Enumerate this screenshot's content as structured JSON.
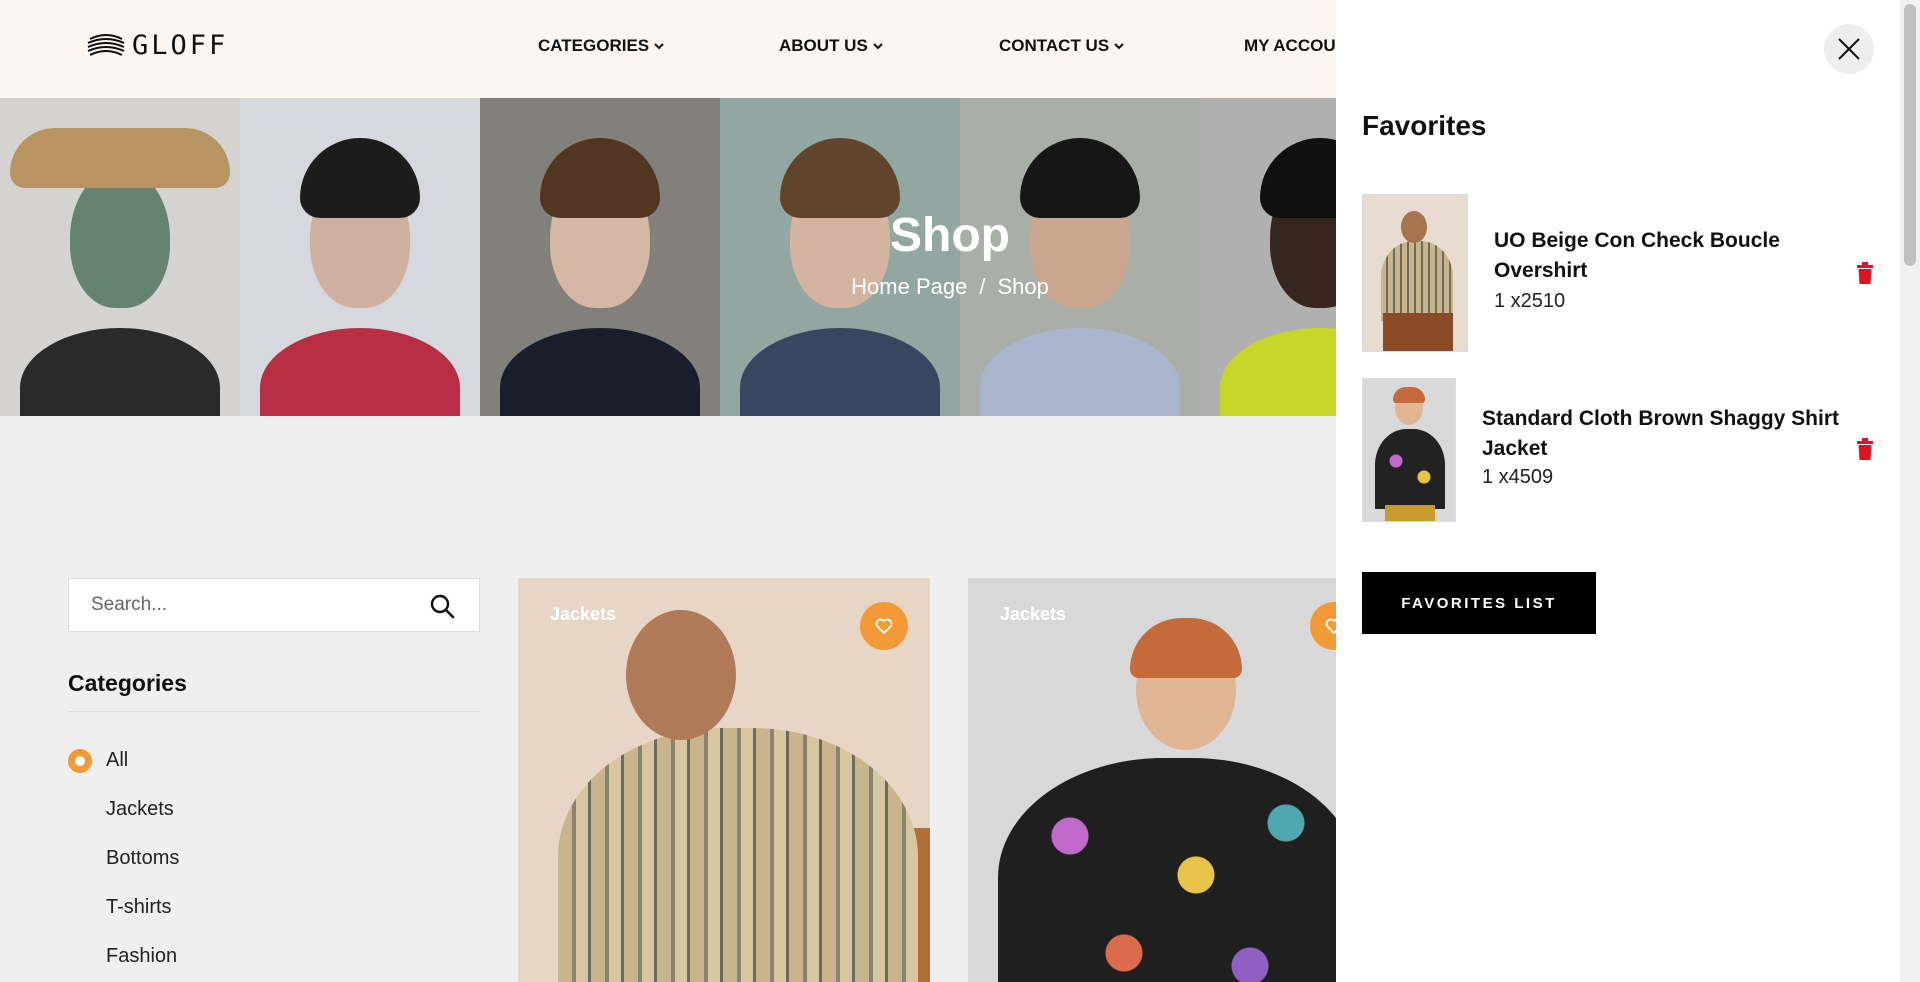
{
  "header": {
    "logo_text": "GLOFF",
    "nav": [
      {
        "label": "CATEGORIES",
        "icon": "chevron-down-icon"
      },
      {
        "label": "ABOUT US",
        "icon": "chevron-down-icon"
      },
      {
        "label": "CONTACT US",
        "icon": "chevron-down-icon"
      },
      {
        "label": "MY ACCOU"
      }
    ]
  },
  "hero": {
    "title": "Shop",
    "breadcrumb": {
      "home": "Home Page",
      "separator": "/",
      "current": "Shop"
    }
  },
  "sidebar": {
    "search_placeholder": "Search...",
    "categories_title": "Categories",
    "categories": [
      {
        "label": "All",
        "selected": true
      },
      {
        "label": "Jackets",
        "selected": false
      },
      {
        "label": "Bottoms",
        "selected": false
      },
      {
        "label": "T-shirts",
        "selected": false
      },
      {
        "label": "Fashion",
        "selected": false
      }
    ]
  },
  "products": [
    {
      "category": "Jackets"
    },
    {
      "category": "Jackets"
    }
  ],
  "drawer": {
    "title": "Favorites",
    "items": [
      {
        "name": "UO Beige Con Check Boucle Overshirt",
        "meta": "1 x2510"
      },
      {
        "name": "Standard Cloth Brown Shaggy Shirt Jacket",
        "meta": "1 x4509"
      }
    ],
    "button_label": "FAVORITES LIST"
  },
  "colors": {
    "accent": "#f29a35",
    "header_bg": "#fdf5f0",
    "delete": "#e0141e"
  }
}
